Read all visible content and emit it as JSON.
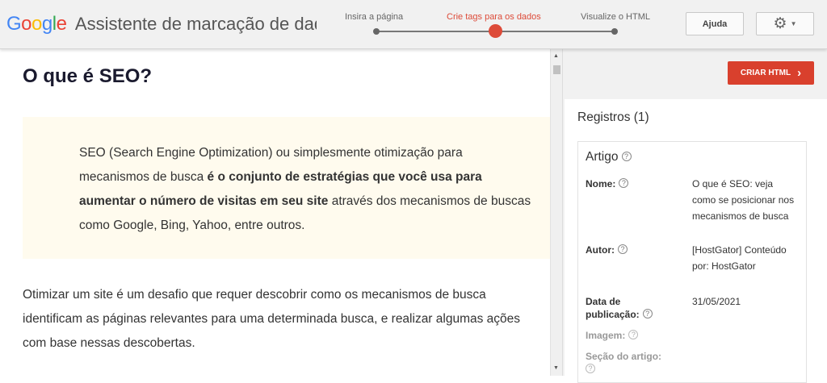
{
  "header": {
    "logo_letters": [
      {
        "ch": "G",
        "color": "#4285F4"
      },
      {
        "ch": "o",
        "color": "#EA4335"
      },
      {
        "ch": "o",
        "color": "#FBBC05"
      },
      {
        "ch": "g",
        "color": "#4285F4"
      },
      {
        "ch": "l",
        "color": "#34A853"
      },
      {
        "ch": "e",
        "color": "#EA4335"
      }
    ],
    "title": "Assistente de marcação de dados",
    "steps": [
      {
        "label": "Insira a página",
        "active": false
      },
      {
        "label": "Crie tags para os dados",
        "active": true
      },
      {
        "label": "Visualize o HTML",
        "active": false
      }
    ],
    "help_label": "Ajuda",
    "gear_icon": "gear-icon",
    "accent_color": "#dd4b39"
  },
  "article": {
    "title": "O que é SEO?",
    "callout": {
      "text_before": "SEO (Search Engine Optimization) ou simplesmente otimização para mecanismos de busca ",
      "text_bold": "é o conjunto de estratégias que você usa para aumentar o número de visitas em seu site",
      "text_after": " através dos mecanismos de buscas como Google, Bing, Yahoo, entre outros."
    },
    "paragraph": "Otimizar um site é um desafio que requer descobrir como os mecanismos de busca identificam as páginas relevantes para uma determinada busca, e realizar algumas ações com base nessas descobertas."
  },
  "panel": {
    "create_button": "CRIAR HTML",
    "records_title": "Registros (1)",
    "card": {
      "title": "Artigo",
      "fields": {
        "name_label": "Nome:",
        "name_value": "O que é SEO: veja como se posicionar nos mecanismos de busca",
        "author_label": "Autor:",
        "author_value": "[HostGator] Conteúdo por: HostGator",
        "date_label": "Data de publicação:",
        "date_value": "31/05/2021",
        "image_label": "Imagem:",
        "section_label": "Seção do artigo:"
      }
    }
  }
}
